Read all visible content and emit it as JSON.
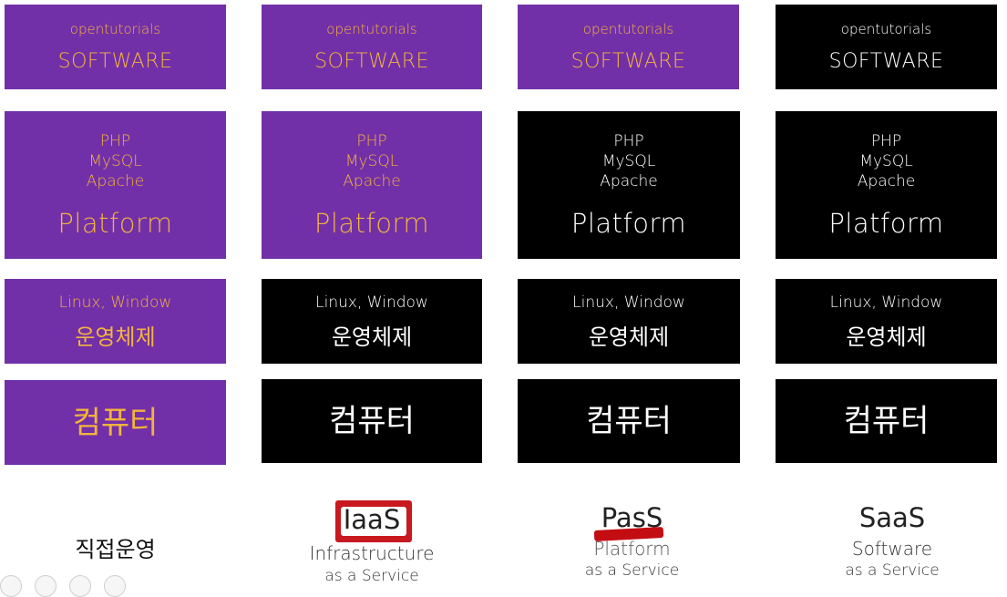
{
  "columns": [
    {
      "software": {
        "top": "opentutorials",
        "label": "SOFTWARE"
      },
      "platform": {
        "stack": [
          "PHP",
          "MySQL",
          "Apache"
        ],
        "label": "Platform"
      },
      "os": {
        "top": "Linux, Window",
        "label": "운영체제"
      },
      "hardware": {
        "label": "컴퓨터"
      },
      "model": {
        "label": "직접운영"
      }
    },
    {
      "software": {
        "top": "opentutorials",
        "label": "SOFTWARE"
      },
      "platform": {
        "stack": [
          "PHP",
          "MySQL",
          "Apache"
        ],
        "label": "Platform"
      },
      "os": {
        "top": "Linux, Window",
        "label": "운영체제"
      },
      "hardware": {
        "label": "컴퓨터"
      },
      "model": {
        "abbr": "IaaS",
        "full": "Infrastructure",
        "suffix": "as a Service"
      }
    },
    {
      "software": {
        "top": "opentutorials",
        "label": "SOFTWARE"
      },
      "platform": {
        "stack": [
          "PHP",
          "MySQL",
          "Apache"
        ],
        "label": "Platform"
      },
      "os": {
        "top": "Linux, Window",
        "label": "운영체제"
      },
      "hardware": {
        "label": "컴퓨터"
      },
      "model": {
        "abbr": "PasS",
        "full": "Platform",
        "suffix": "as a Service"
      }
    },
    {
      "software": {
        "top": "opentutorials",
        "label": "SOFTWARE"
      },
      "platform": {
        "stack": [
          "PHP",
          "MySQL",
          "Apache"
        ],
        "label": "Platform"
      },
      "os": {
        "top": "Linux, Window",
        "label": "운영체제"
      },
      "hardware": {
        "label": "컴퓨터"
      },
      "model": {
        "abbr": "SaaS",
        "full": "Software",
        "suffix": "as a Service"
      }
    }
  ],
  "colors": {
    "purple": "#7230a8",
    "orange_text": "#f2b33d",
    "black": "#000000",
    "highlight": "#c40d13"
  }
}
